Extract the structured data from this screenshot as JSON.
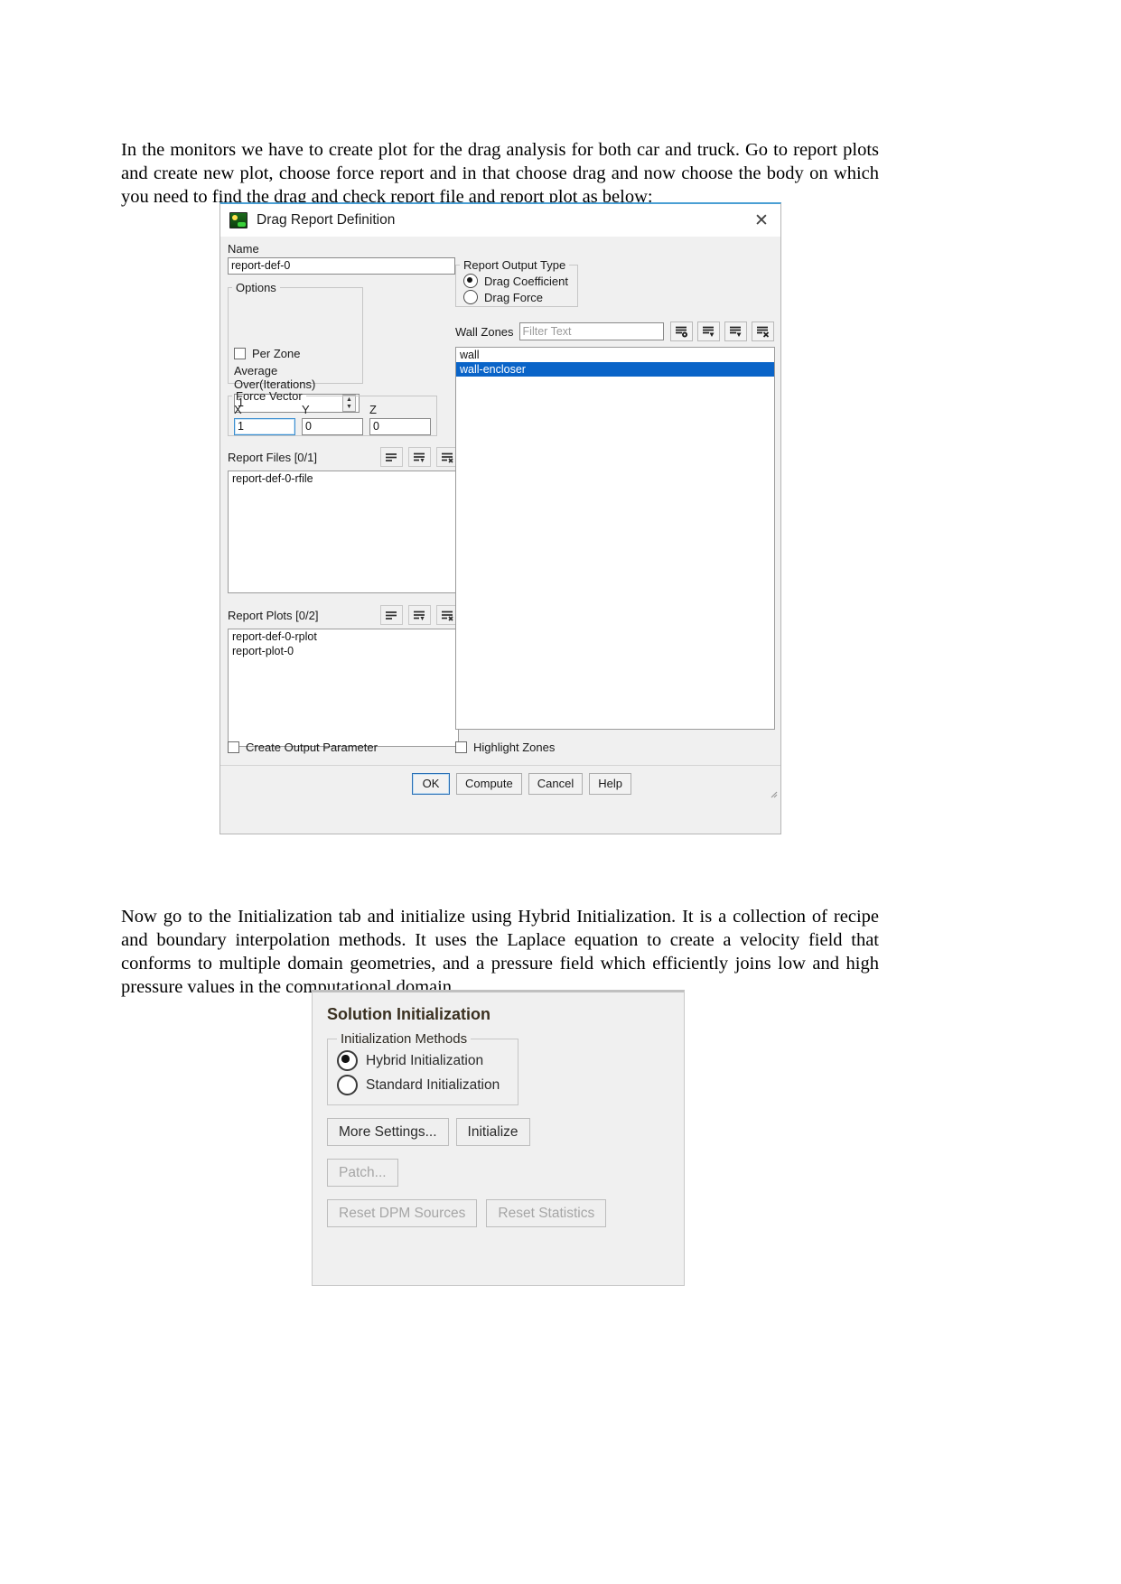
{
  "document": {
    "paragraph_1": "In the monitors we have to create plot for the drag analysis for both car and truck. Go to report plots and create new plot, choose force report and in that choose drag and now choose the body on which you need to find the drag and check report file and report plot as below:",
    "paragraph_2": "Now go to the Initialization tab and initialize using Hybrid Initialization. It is a collection of recipe and boundary interpolation methods. It uses the Laplace equation to create a velocity field that conforms to multiple domain geometries, and a pressure field which efficiently joins low and high pressure values in the computational domain."
  },
  "drag_dialog": {
    "title": "Drag Report Definition",
    "close_label": "✕",
    "name_label": "Name",
    "name_value": "report-def-0",
    "options": {
      "legend": "Options",
      "per_zone_label": "Per Zone",
      "per_zone_checked": false,
      "average_over_label": "Average Over(Iterations)",
      "average_over_value": "1"
    },
    "force_vector": {
      "legend": "Force Vector",
      "x_label": "X",
      "y_label": "Y",
      "z_label": "Z",
      "x_value": "1",
      "y_value": "0",
      "z_value": "0"
    },
    "report_output_type": {
      "legend": "Report Output Type",
      "options": [
        {
          "label": "Drag Coefficient",
          "selected": true
        },
        {
          "label": "Drag Force",
          "selected": false
        }
      ]
    },
    "wall_zones": {
      "label": "Wall Zones",
      "filter_placeholder": "Filter Text",
      "filter_value": "",
      "items": [
        {
          "label": "wall",
          "selected": false
        },
        {
          "label": "wall-encloser",
          "selected": true
        }
      ]
    },
    "report_files": {
      "label": "Report Files  [0/1]",
      "items": [
        "report-def-0-rfile"
      ]
    },
    "report_plots": {
      "label": "Report Plots  [0/2]",
      "items": [
        "report-def-0-rplot",
        "report-plot-0"
      ]
    },
    "create_output_parameter": {
      "label": "Create Output Parameter",
      "checked": false
    },
    "highlight_zones": {
      "label": "Highlight Zones",
      "checked": false
    },
    "buttons": [
      {
        "label": "OK",
        "default": true
      },
      {
        "label": "Compute",
        "default": false
      },
      {
        "label": "Cancel",
        "default": false
      },
      {
        "label": "Help",
        "default": false
      }
    ],
    "accent_color": "#0a64c8",
    "titlebar_accent": "#4a9fd4"
  },
  "solution_init": {
    "title": "Solution Initialization",
    "methods_legend": "Initialization Methods",
    "methods": [
      {
        "label": "Hybrid  Initialization",
        "selected": true
      },
      {
        "label": "Standard Initialization",
        "selected": false
      }
    ],
    "more_settings_label": "More Settings...",
    "initialize_label": "Initialize",
    "patch_label": "Patch...",
    "reset_dpm_label": "Reset DPM Sources",
    "reset_statistics_label": "Reset Statistics",
    "title_color": "#3a3020"
  }
}
